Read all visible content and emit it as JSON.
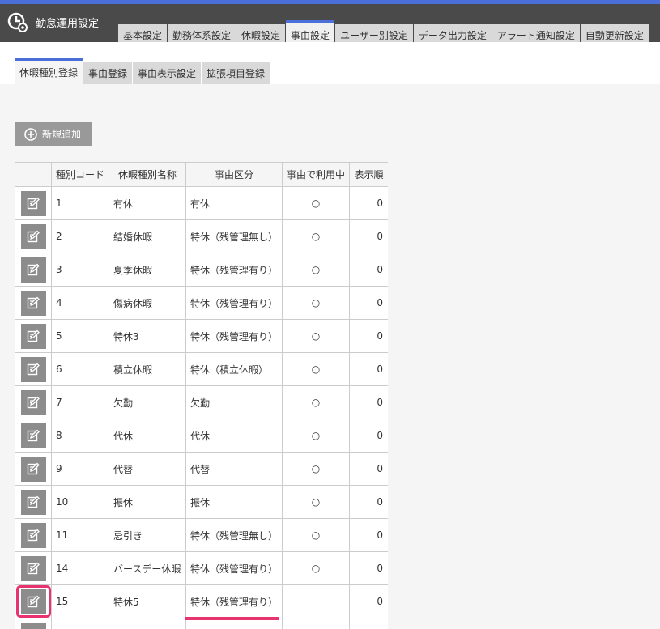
{
  "app": {
    "title": "勤怠運用設定",
    "logo_icon": "clock-icon"
  },
  "main_tabs": [
    {
      "label": "基本設定"
    },
    {
      "label": "勤務体系設定"
    },
    {
      "label": "休暇設定"
    },
    {
      "label": "事由設定",
      "active": true
    },
    {
      "label": "ユーザー別設定"
    },
    {
      "label": "データ出力設定"
    },
    {
      "label": "アラート通知設定"
    },
    {
      "label": "自動更新設定"
    }
  ],
  "sub_tabs": [
    {
      "label": "休暇種別登録",
      "active": true
    },
    {
      "label": "事由登録"
    },
    {
      "label": "事由表示設定"
    },
    {
      "label": "拡張項目登録"
    }
  ],
  "toolbar": {
    "add_label": "新規追加",
    "add_icon": "plus-circle-icon"
  },
  "table": {
    "headers": [
      "",
      "種別コード",
      "休暇種別名称",
      "事由区分",
      "事由で利用中",
      "表示順"
    ],
    "rows": [
      {
        "code": "1",
        "name": "有休",
        "category": "有休",
        "used": "○",
        "order": "0"
      },
      {
        "code": "2",
        "name": "結婚休暇",
        "category": "特休（残管理無し）",
        "used": "○",
        "order": "0"
      },
      {
        "code": "3",
        "name": "夏季休暇",
        "category": "特休（残管理有り）",
        "used": "○",
        "order": "0"
      },
      {
        "code": "4",
        "name": "傷病休暇",
        "category": "特休（残管理有り）",
        "used": "○",
        "order": "0"
      },
      {
        "code": "5",
        "name": "特休3",
        "category": "特休（残管理有り）",
        "used": "○",
        "order": "0"
      },
      {
        "code": "6",
        "name": "積立休暇",
        "category": "特休（積立休暇）",
        "used": "○",
        "order": "0"
      },
      {
        "code": "7",
        "name": "欠勤",
        "category": "欠勤",
        "used": "○",
        "order": "0"
      },
      {
        "code": "8",
        "name": "代休",
        "category": "代休",
        "used": "○",
        "order": "0"
      },
      {
        "code": "9",
        "name": "代替",
        "category": "代替",
        "used": "○",
        "order": "0"
      },
      {
        "code": "10",
        "name": "振休",
        "category": "振休",
        "used": "○",
        "order": "0"
      },
      {
        "code": "11",
        "name": "忌引き",
        "category": "特休（残管理無し）",
        "used": "○",
        "order": "0"
      },
      {
        "code": "14",
        "name": "バースデー休暇",
        "category": "特休（残管理有り）",
        "used": "○",
        "order": "0"
      },
      {
        "code": "15",
        "name": "特休5",
        "category": "特休（残管理有り）",
        "used": "",
        "order": "0"
      },
      {
        "code": "",
        "name": "",
        "category": "",
        "used": "",
        "order": ""
      }
    ],
    "edit_icon": "edit-icon"
  },
  "colors": {
    "accent": "#4a6fd8",
    "highlight": "#e8336f",
    "topbar": "#4a4a4a"
  }
}
